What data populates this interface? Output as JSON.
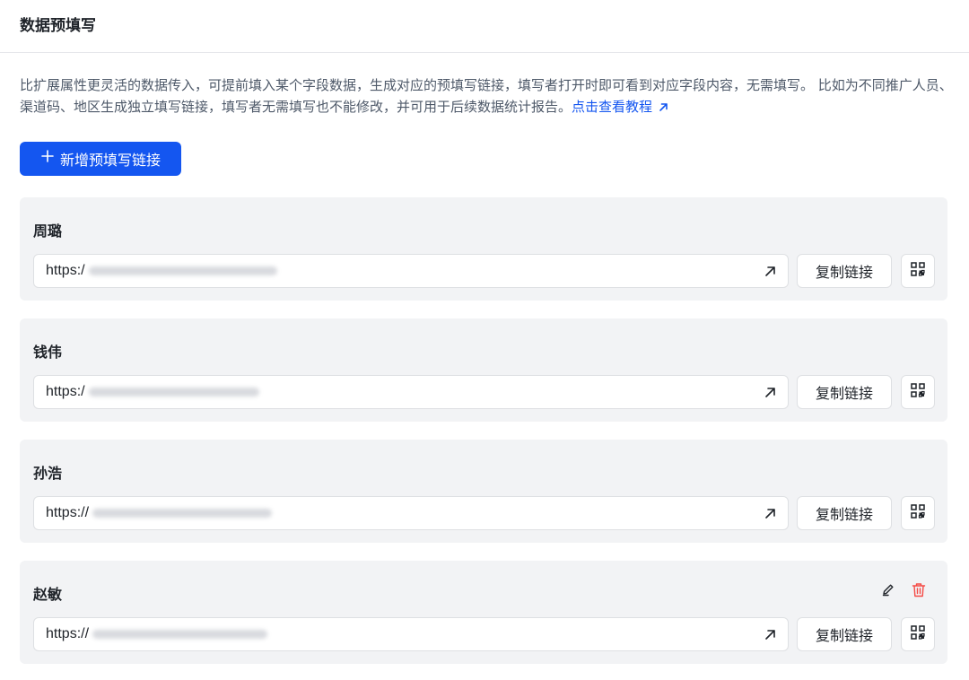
{
  "page": {
    "title": "数据预填写"
  },
  "description": {
    "text": "比扩展属性更灵活的数据传入，可提前填入某个字段数据，生成对应的预填写链接，填写者打开时即可看到对应字段内容，无需填写。 比如为不同推广人员、渠道码、地区生成独立填写链接，填写者无需填写也不能修改，并可用于后续数据统计报告。",
    "link_label": "点击查看教程",
    "link_icon": "external-arrow-icon"
  },
  "add_button": {
    "label": "新增预填写链接",
    "icon": "plus-icon"
  },
  "colors": {
    "primary": "#1456f0",
    "card_bg": "#f2f3f5",
    "danger": "#f54a45",
    "text": "#1f2329"
  },
  "cards": [
    {
      "name": "周璐",
      "url_prefix": "https:/",
      "copy_label": "复制链接",
      "show_actions": false
    },
    {
      "name": "钱伟",
      "url_prefix": "https:/",
      "copy_label": "复制链接",
      "show_actions": false
    },
    {
      "name": "孙浩",
      "url_prefix": "https://",
      "copy_label": "复制链接",
      "show_actions": false
    },
    {
      "name": "赵敏",
      "url_prefix": "https://",
      "copy_label": "复制链接",
      "show_actions": true
    }
  ]
}
